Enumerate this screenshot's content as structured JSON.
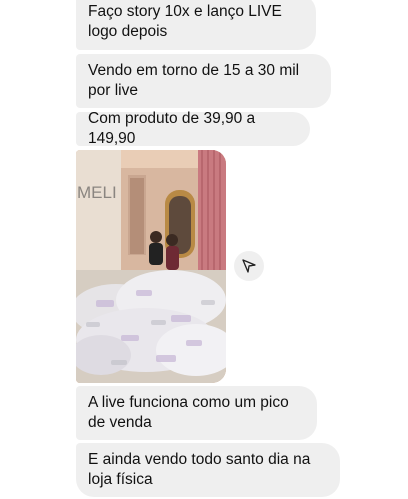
{
  "messages": [
    {
      "text": "Faço story 10x e lanço LIVE logo depois"
    },
    {
      "text": "Vendo em torno de 15 a 30 mil por live"
    },
    {
      "text": "Com produto de 39,90 a 149,90"
    },
    {
      "text": "A live funciona como um pico de venda"
    },
    {
      "text": "E ainda vendo todo santo dia na loja física"
    }
  ],
  "photo": {
    "wall_sign": "MELI"
  },
  "icons": {
    "share": "paper-plane-icon"
  }
}
